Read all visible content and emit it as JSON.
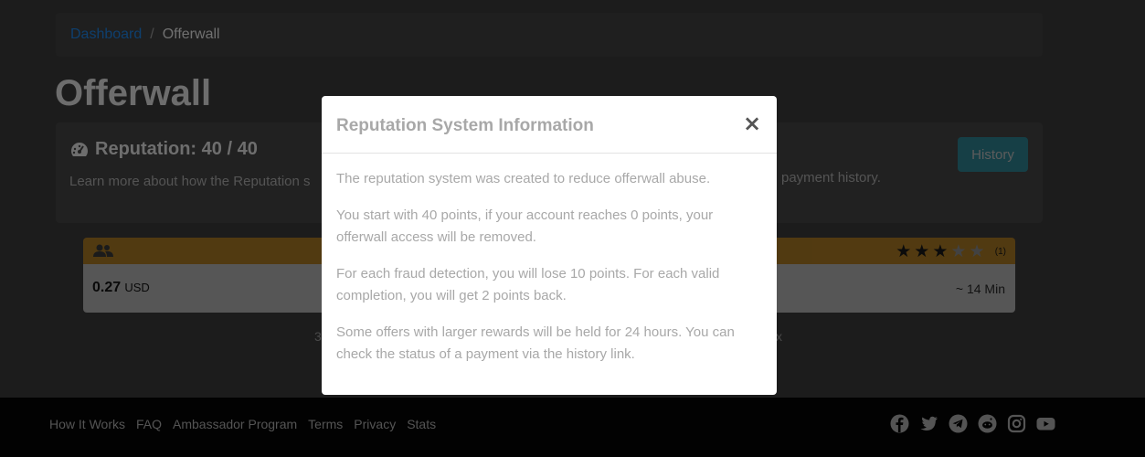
{
  "breadcrumb": {
    "home": "Dashboard",
    "current": "Offerwall"
  },
  "page": {
    "title": "Offerwall"
  },
  "reputation": {
    "title": "Reputation: 40 / 40",
    "description": "Learn more about how the Reputation s",
    "description_tail": "payment history.",
    "history_button": "History",
    "icon": "gauge-icon"
  },
  "offer": {
    "price_value": "0.27",
    "price_currency": "USD",
    "duration": "~ 14 Min",
    "rating": 3,
    "rating_max": 5,
    "rating_count": "(1)",
    "icon": "users-icon"
  },
  "pager": {
    "left": "3",
    "right": "x"
  },
  "modal": {
    "title": "Reputation System Information",
    "close": "×",
    "paragraphs": [
      "The reputation system was created to reduce offerwall abuse.",
      "You start with 40 points, if your account reaches 0 points, your offerwall access will be removed.",
      "For each fraud detection, you will lose 10 points. For each valid completion, you will get 2 points back.",
      "Some offers with larger rewards will be held for 24 hours. You can check the status of a payment via the history link."
    ]
  },
  "footer": {
    "links": [
      "How It Works",
      "FAQ",
      "Ambassador Program",
      "Terms",
      "Privacy",
      "Stats"
    ],
    "social": [
      "facebook-icon",
      "twitter-icon",
      "telegram-icon",
      "reddit-icon",
      "instagram-icon",
      "youtube-icon"
    ]
  },
  "colors": {
    "accent": "#17a2b8",
    "offer_header": "#d68f14",
    "link": "#1a73c8"
  }
}
